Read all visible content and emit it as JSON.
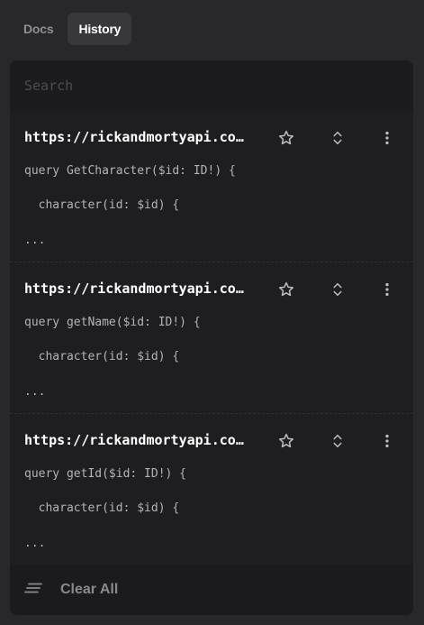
{
  "tabs": [
    {
      "label": "Docs",
      "active": false
    },
    {
      "label": "History",
      "active": true
    }
  ],
  "search": {
    "placeholder": "Search",
    "value": ""
  },
  "history": [
    {
      "title": "https://rickandmortyapi.com/graphql",
      "lines": [
        "query GetCharacter($id: ID!) {",
        "  character(id: $id) {",
        "..."
      ]
    },
    {
      "title": "https://rickandmortyapi.com/graphql",
      "lines": [
        "query getName($id: ID!) {",
        "  character(id: $id) {",
        "..."
      ]
    },
    {
      "title": "https://rickandmortyapi.com/graphql",
      "lines": [
        "query getId($id: ID!) {",
        "  character(id: $id) {",
        "..."
      ]
    }
  ],
  "icons": {
    "favorite": "star-icon",
    "expand": "unfold-icon",
    "menu": "more-vertical-icon",
    "clear": "clear-all-icon"
  },
  "footer": {
    "clear_label": "Clear All"
  },
  "colors": {
    "background": "#28282b",
    "panel": "#1e1e21",
    "muted": "#8a8a8d"
  }
}
